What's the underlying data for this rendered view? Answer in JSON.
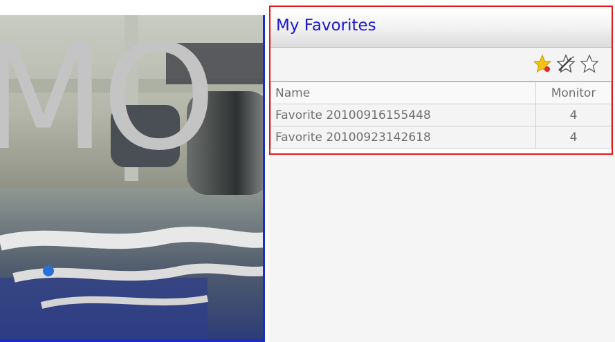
{
  "camera": {
    "overlay_text": "MO"
  },
  "favorites": {
    "title": "My Favorites",
    "toolbar": {
      "add_icon": "star-add-icon",
      "edit_icon": "star-edit-icon",
      "delete_icon": "star-delete-icon"
    },
    "columns": [
      "Name",
      "Monitor"
    ],
    "rows": [
      {
        "name": "Favorite 20100916155448",
        "monitor": "4"
      },
      {
        "name": "Favorite 20100923142618",
        "monitor": "4"
      }
    ]
  },
  "colors": {
    "title": "#1a17d6",
    "panel_border": "#e01818",
    "camera_border": "#1c2ccc"
  }
}
